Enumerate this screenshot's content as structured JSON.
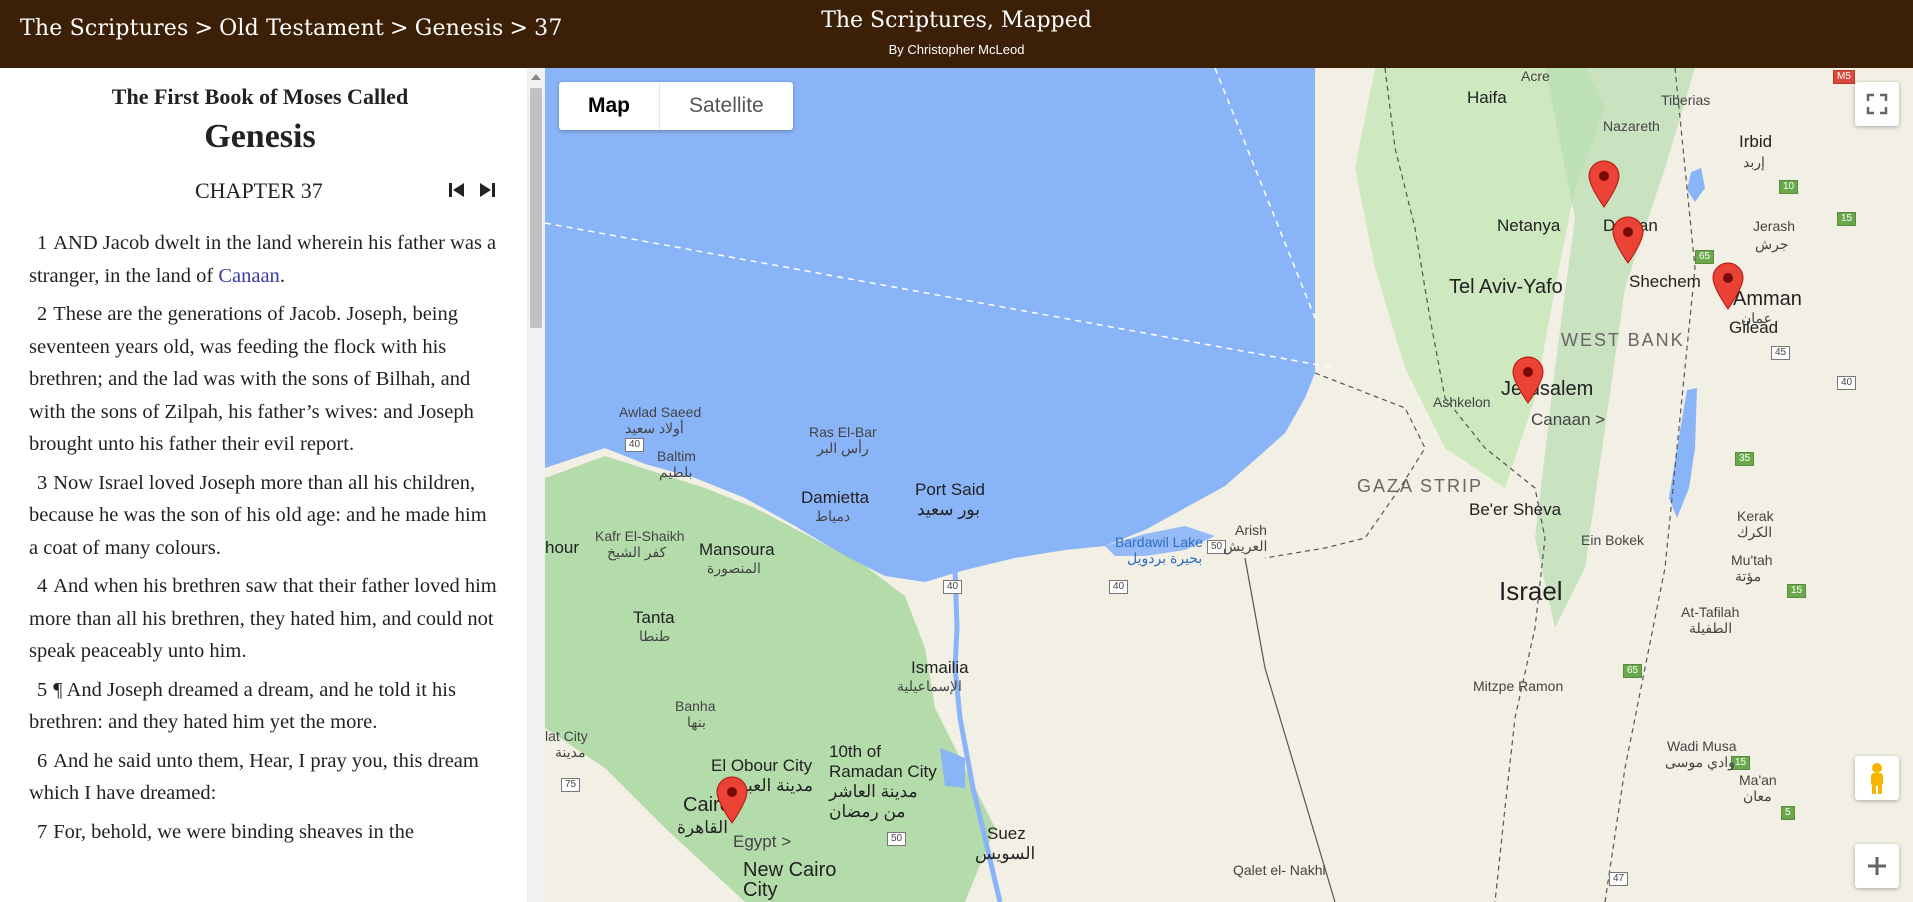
{
  "header": {
    "breadcrumbs": [
      "The Scriptures",
      "Old Testament",
      "Genesis",
      "37"
    ],
    "separator": ">",
    "site_title": "The Scriptures, Mapped",
    "byline": "By Christopher McLeod"
  },
  "scripture": {
    "book_title_pre": "The First Book of Moses Called",
    "book_name": "Genesis",
    "chapter_heading": "CHAPTER 37",
    "prev_icon": "skip-previous-icon",
    "next_icon": "skip-next-icon",
    "link_color": "#3a3aa5",
    "verses": [
      {
        "num": "1",
        "pre": "AND Jacob dwelt in the land wherein his father was a stranger, in the land of ",
        "link": "Canaan",
        "post": "."
      },
      {
        "num": "2",
        "pre": "These are the generations of Jacob. Joseph, being seventeen years old, was feeding the flock with his brethren; and the lad was with the sons of Bilhah, and with the sons of Zilpah, his father’s wives: and Joseph brought unto his father their evil report.",
        "link": "",
        "post": ""
      },
      {
        "num": "3",
        "pre": "Now Israel loved Joseph more than all his children, because he was the son of his old age: and he made him a coat of many colours.",
        "link": "",
        "post": ""
      },
      {
        "num": "4",
        "pre": "And when his brethren saw that their father loved him more than all his brethren, they hated him, and could not speak peaceably unto him.",
        "link": "",
        "post": ""
      },
      {
        "num": "5",
        "pre": "¶ And Joseph dreamed a dream, and he told it his brethren: and they hated him yet the more.",
        "link": "",
        "post": ""
      },
      {
        "num": "6",
        "pre": "And he said unto them, Hear, I pray you, this dream which I have dreamed:",
        "link": "",
        "post": ""
      },
      {
        "num": "7",
        "pre": "For, behold, we were binding sheaves in the",
        "link": "",
        "post": ""
      }
    ]
  },
  "map": {
    "map_type_options": [
      "Map",
      "Satellite"
    ],
    "active_map_type": "Map",
    "colors": {
      "sea": "#8ab4f8",
      "land": "#f2efe5",
      "green": "#a8d8a0",
      "pin": "#ea4335"
    },
    "sea_label": {
      "en": "Bardawil Lake",
      "ar": "بحيرة بردويل"
    },
    "country_label": "Israel",
    "regions": [
      "WEST BANK",
      "GAZA STRIP"
    ],
    "place_links": [
      "Canaan >",
      "Egypt >"
    ],
    "markers": [
      "Dothan",
      "Shechem",
      "Gilead",
      "Jerusalem",
      "Cairo"
    ],
    "labels": {
      "haifa": "Haifa",
      "acre": "Acre",
      "tiberias": "Tiberias",
      "nazareth": "Nazareth",
      "irbid_en": "Irbid",
      "irbid_ar": "إربد",
      "netanya": "Netanya",
      "dothan": "Dothan",
      "shechem": "Shechem",
      "jerash_en": "Jerash",
      "jerash_ar": "جرش",
      "telaviv": "Tel Aviv-Yafo",
      "amman_en": "Amman",
      "amman_ar": "عمان",
      "gilead": "Gilead",
      "ashkelon": "Ashkelon",
      "jerusalem": "Jerusalem",
      "beersheva": "Be'er Sheva",
      "einbokek": "Ein Bokek",
      "kerak_en": "Kerak",
      "kerak_ar": "الكرك",
      "mutah_en": "Mu'tah",
      "mutah_ar": "مؤتة",
      "tafilah_en": "At-Tafilah",
      "tafilah_ar": "الطفيلة",
      "mitzpe": "Mitzpe Ramon",
      "wadimusa_en": "Wadi Musa",
      "wadimusa_ar": "وادي موسى",
      "maan_en": "Ma'an",
      "maan_ar": "معان",
      "arish_en": "Arish",
      "arish_ar": "العريش",
      "portsaid_en": "Port Said",
      "portsaid_ar": "بور سعيد",
      "damietta_en": "Damietta",
      "damietta_ar": "دمياط",
      "rasbar_en": "Ras El-Bar",
      "rasbar_ar": "رأس البر",
      "awlad_en": "Awlad Saeed",
      "awlad_ar": "أولاد سعيد",
      "baltim_en": "Baltim",
      "baltim_ar": "بلطيم",
      "kafr_en": "Kafr El-Shaikh",
      "kafr_ar": "كفر الشيخ",
      "mansoura_en": "Mansoura",
      "mansoura_ar": "المنصورة",
      "tanta_en": "Tanta",
      "tanta_ar": "طنطا",
      "ismailia_en": "Ismailia",
      "ismailia_ar": "الإسماعيلية",
      "banha_en": "Banha",
      "banha_ar": "بنها",
      "obour_en": "El Obour City",
      "obour_ar": "مدينة العبور",
      "tenth_en": "10th of Ramadan City",
      "tenth_ar": "مدينة العاشر من رمضان",
      "cairo_en": "Cairo",
      "cairo_ar": "القاهرة",
      "newcairo": "New Cairo City",
      "suez_en": "Suez",
      "suez_ar": "السويس",
      "qalet": "Qalet el- Nakhl",
      "hour": "hour",
      "sadat_en": "lat City",
      "sadat_ar": "مدينة"
    },
    "road_shields": [
      "M5",
      "10",
      "15",
      "65",
      "45",
      "40",
      "35",
      "15",
      "5",
      "15",
      "65",
      "47",
      "50",
      "40",
      "40",
      "40",
      "75",
      "50"
    ],
    "controls": {
      "fullscreen_icon": "fullscreen-icon",
      "pegman_icon": "pegman-icon",
      "zoom_in_icon": "zoom-in-icon"
    }
  }
}
